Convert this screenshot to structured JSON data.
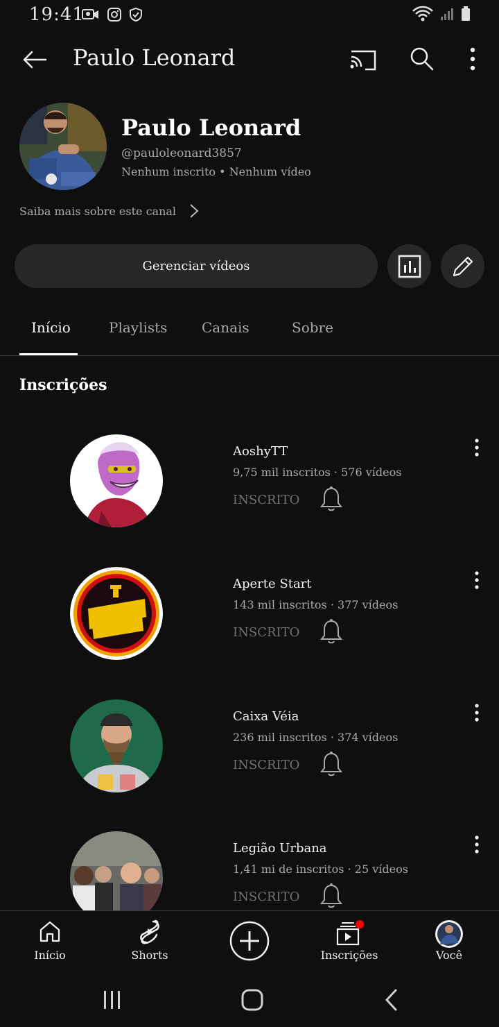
{
  "status": {
    "time": "19:41"
  },
  "header": {
    "title": "Paulo Leonard"
  },
  "channel": {
    "name": "Paulo Leonard",
    "handle": "@pauloleonard3857",
    "stats": "Nenhum inscrito • Nenhum vídeo",
    "about": "Saiba mais sobre este canal",
    "manage_label": "Gerenciar vídeos"
  },
  "tabs": [
    {
      "label": "Início"
    },
    {
      "label": "Playlists"
    },
    {
      "label": "Canais"
    },
    {
      "label": "Sobre"
    }
  ],
  "section_title": "Inscrições",
  "subscriptions": [
    {
      "name": "AoshyTT",
      "meta": "9,75 mil inscritos · 576 vídeos",
      "button": "INSCRITO"
    },
    {
      "name": "Aperte Start",
      "meta": "143 mil inscritos · 377 vídeos",
      "button": "INSCRITO"
    },
    {
      "name": "Caixa Véia",
      "meta": "236 mil inscritos · 374 vídeos",
      "button": "INSCRITO"
    },
    {
      "name": "Legião Urbana",
      "meta": "1,41 mi de inscritos · 25 vídeos",
      "button": "INSCRITO"
    }
  ],
  "bottom_nav": [
    {
      "label": "Início",
      "icon": "home-icon"
    },
    {
      "label": "Shorts",
      "icon": "shorts-icon"
    },
    {
      "label": "",
      "icon": "create-icon"
    },
    {
      "label": "Inscrições",
      "icon": "subscriptions-icon"
    },
    {
      "label": "Você",
      "icon": "you-avatar-icon"
    }
  ],
  "colors": {
    "background": "#0f0f0f",
    "surface": "#272727",
    "notification": "#ff0000"
  }
}
